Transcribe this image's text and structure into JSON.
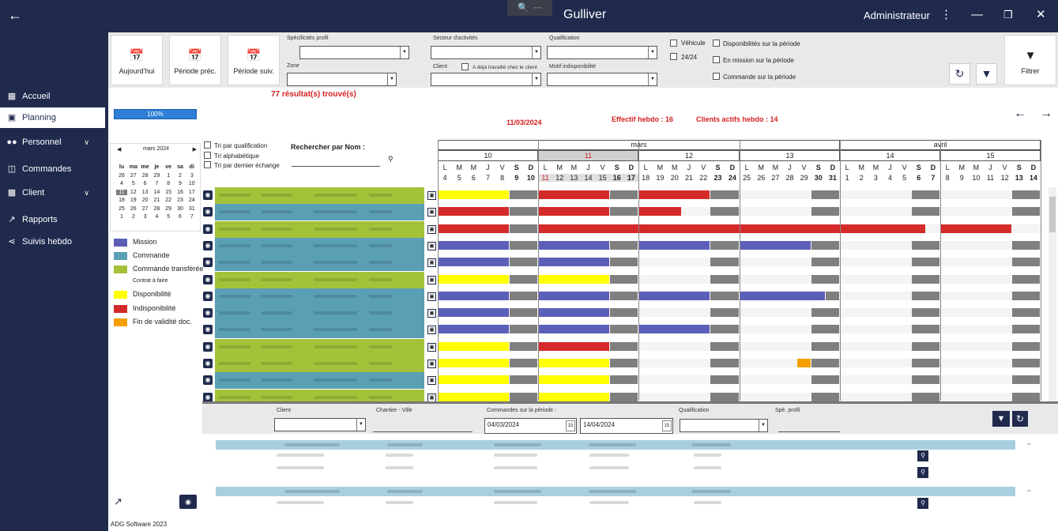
{
  "app": {
    "title": "Gulliver",
    "user": "Administrateur",
    "footer": "ADG Software 2023"
  },
  "sidebar": {
    "items": [
      {
        "label": "Accueil",
        "icon": "dashboard-icon"
      },
      {
        "label": "Planning",
        "icon": "calendar-icon",
        "active": true
      },
      {
        "label": "Personnel",
        "icon": "people-icon",
        "expandable": true
      },
      {
        "label": "Commandes",
        "icon": "orders-icon"
      },
      {
        "label": "Client",
        "icon": "building-icon",
        "expandable": true
      },
      {
        "label": "Rapports",
        "icon": "chart-icon"
      },
      {
        "label": "Suivis hebdo",
        "icon": "share-icon"
      }
    ]
  },
  "toolbar": {
    "today": "Aujourd'hui",
    "prev": "Période préc.",
    "next": "Période suiv.",
    "spec_profil": "Spécificités profil",
    "zone": "Zone",
    "secteur": "Secteur d'activités",
    "client": "Client",
    "deja_travaille": "A déjà travaillé chez le client",
    "qualification": "Qualification",
    "motif": "Motif indisponibilité",
    "vehicule": "Véhicule",
    "h24": "24/24",
    "dispo": "Disponibilités sur la période",
    "mission": "En mission sur la période",
    "commande": "Commande sur la période",
    "filtrer": "Filtrer"
  },
  "results": "77 résultat(s) trouvé(s)",
  "progress": {
    "label": "100%",
    "value": 100
  },
  "current_date": "11/03/2024",
  "effectif": "Effectif hebdo : 16",
  "clients_actifs": "Clients actifs hebdo : 14",
  "sort": {
    "by_qualification": "Tri par qualification",
    "alpha": "Tri alphabétique",
    "last_exchange": "Tri par dernier échange",
    "search_label": "Rechercher par Nom :"
  },
  "mini_calendar": {
    "month": "mars 2024",
    "days": [
      "lu",
      "ma",
      "me",
      "je",
      "ve",
      "sa",
      "di"
    ],
    "weeks": [
      [
        "26",
        "27",
        "28",
        "29",
        "1",
        "2",
        "3"
      ],
      [
        "4",
        "5",
        "6",
        "7",
        "8",
        "9",
        "10"
      ],
      [
        "11",
        "12",
        "13",
        "14",
        "15",
        "16",
        "17"
      ],
      [
        "18",
        "19",
        "20",
        "21",
        "22",
        "23",
        "24"
      ],
      [
        "25",
        "26",
        "27",
        "28",
        "29",
        "30",
        "31"
      ],
      [
        "1",
        "2",
        "3",
        "4",
        "5",
        "6",
        "7"
      ]
    ],
    "selected": "11"
  },
  "legend": [
    {
      "label": "Mission",
      "color": "#5b5fb8"
    },
    {
      "label": "Commande",
      "color": "#5b9fb4"
    },
    {
      "label": "Commande transférée",
      "color": "#a3c23a"
    },
    {
      "label": "Contrat à faire",
      "color": null
    },
    {
      "label": "Disponibilité",
      "color": "#ffff00"
    },
    {
      "label": "Indisponibilité",
      "color": "#d42a2a"
    },
    {
      "label": "Fin de validité doc.",
      "color": "#f5a000"
    }
  ],
  "planner": {
    "months": [
      {
        "name": "mars",
        "start": 0,
        "end": 28
      },
      {
        "name": "avril",
        "start": 28,
        "end": 42
      }
    ],
    "weeks": [
      "10",
      "11",
      "12",
      "13",
      "14",
      "15"
    ],
    "highlight_week": "11",
    "day_letters": [
      "L",
      "M",
      "M",
      "J",
      "V",
      "S",
      "D"
    ],
    "days": [
      "4",
      "5",
      "6",
      "7",
      "8",
      "9",
      "10",
      "11",
      "12",
      "13",
      "14",
      "15",
      "16",
      "17",
      "18",
      "19",
      "20",
      "21",
      "22",
      "23",
      "24",
      "25",
      "26",
      "27",
      "28",
      "29",
      "30",
      "31",
      "1",
      "2",
      "3",
      "4",
      "5",
      "6",
      "7",
      "8",
      "9",
      "10",
      "11",
      "12",
      "13",
      "14"
    ],
    "rows": [
      {
        "type": "Commande transférée",
        "segs": [
          [
            "yellow",
            0,
            5
          ],
          [
            "red",
            7,
            12
          ],
          [
            "red",
            14,
            19
          ],
          [
            "grey",
            5,
            7
          ],
          [
            "grey",
            12,
            14
          ],
          [
            "grey",
            19,
            21
          ],
          [
            "grey",
            26,
            28
          ],
          [
            "grey",
            33,
            35
          ],
          [
            "grey",
            40,
            42
          ]
        ]
      },
      {
        "type": "Commande",
        "segs": [
          [
            "red",
            0,
            5
          ],
          [
            "red",
            7,
            12
          ],
          [
            "red",
            14,
            17
          ],
          [
            "grey",
            5,
            7
          ],
          [
            "grey",
            12,
            14
          ],
          [
            "grey",
            19,
            21
          ],
          [
            "grey",
            26,
            28
          ],
          [
            "grey",
            33,
            35
          ],
          [
            "grey",
            40,
            42
          ]
        ]
      },
      {
        "type": "Commande transférée",
        "segs": [
          [
            "red",
            0,
            5
          ],
          [
            "red",
            7,
            34
          ],
          [
            "red",
            35,
            40
          ],
          [
            "grey",
            5,
            7
          ]
        ]
      },
      {
        "type": "Commande",
        "segs": [
          [
            "purple",
            0,
            5
          ],
          [
            "purple",
            7,
            12
          ],
          [
            "purple",
            14,
            19
          ],
          [
            "purple",
            21,
            26
          ],
          [
            "grey",
            5,
            7
          ],
          [
            "grey",
            12,
            14
          ],
          [
            "grey",
            19,
            21
          ],
          [
            "grey",
            26,
            28
          ],
          [
            "grey",
            33,
            35
          ],
          [
            "grey",
            40,
            42
          ]
        ]
      },
      {
        "type": "Commande",
        "segs": [
          [
            "purple",
            0,
            5
          ],
          [
            "purple",
            7,
            12
          ],
          [
            "grey",
            5,
            7
          ],
          [
            "grey",
            12,
            14
          ],
          [
            "grey",
            19,
            21
          ],
          [
            "grey",
            26,
            28
          ],
          [
            "grey",
            33,
            35
          ],
          [
            "grey",
            40,
            42
          ]
        ]
      },
      {
        "type": "Commande transférée",
        "segs": [
          [
            "yellow",
            0,
            5
          ],
          [
            "yellow",
            7,
            12
          ],
          [
            "grey",
            5,
            7
          ],
          [
            "grey",
            12,
            14
          ],
          [
            "grey",
            19,
            21
          ],
          [
            "grey",
            26,
            28
          ],
          [
            "grey",
            33,
            35
          ],
          [
            "grey",
            40,
            42
          ]
        ]
      },
      {
        "type": "Commande",
        "segs": [
          [
            "purple",
            0,
            5
          ],
          [
            "purple",
            7,
            12
          ],
          [
            "purple",
            14,
            19
          ],
          [
            "purple",
            21,
            27
          ],
          [
            "grey",
            5,
            7
          ],
          [
            "grey",
            12,
            14
          ],
          [
            "grey",
            19,
            21
          ],
          [
            "grey",
            27,
            28
          ],
          [
            "grey",
            33,
            35
          ],
          [
            "grey",
            40,
            42
          ]
        ]
      },
      {
        "type": "Commande",
        "segs": [
          [
            "purple",
            0,
            5
          ],
          [
            "purple",
            7,
            12
          ],
          [
            "grey",
            5,
            7
          ],
          [
            "grey",
            12,
            14
          ],
          [
            "grey",
            19,
            21
          ],
          [
            "grey",
            26,
            28
          ],
          [
            "grey",
            33,
            35
          ],
          [
            "grey",
            40,
            42
          ]
        ]
      },
      {
        "type": "Commande",
        "segs": [
          [
            "purple",
            0,
            5
          ],
          [
            "purple",
            7,
            12
          ],
          [
            "purple",
            14,
            19
          ],
          [
            "grey",
            5,
            7
          ],
          [
            "grey",
            12,
            14
          ],
          [
            "grey",
            19,
            21
          ],
          [
            "grey",
            26,
            28
          ],
          [
            "grey",
            33,
            35
          ],
          [
            "grey",
            40,
            42
          ]
        ]
      },
      {
        "type": "Commande transférée",
        "segs": [
          [
            "yellow",
            0,
            5
          ],
          [
            "red",
            7,
            12
          ],
          [
            "grey",
            5,
            7
          ],
          [
            "grey",
            12,
            14
          ],
          [
            "grey",
            19,
            21
          ],
          [
            "grey",
            26,
            28
          ],
          [
            "grey",
            33,
            35
          ],
          [
            "grey",
            40,
            42
          ]
        ]
      },
      {
        "type": "Commande transférée",
        "segs": [
          [
            "yellow",
            0,
            5
          ],
          [
            "yellow",
            7,
            12
          ],
          [
            "orange",
            25,
            26
          ],
          [
            "grey",
            5,
            7
          ],
          [
            "grey",
            12,
            14
          ],
          [
            "grey",
            19,
            21
          ],
          [
            "grey",
            26,
            28
          ],
          [
            "grey",
            33,
            35
          ],
          [
            "grey",
            40,
            42
          ]
        ]
      },
      {
        "type": "Commande",
        "segs": [
          [
            "yellow",
            0,
            5
          ],
          [
            "yellow",
            7,
            12
          ],
          [
            "grey",
            5,
            7
          ],
          [
            "grey",
            12,
            14
          ],
          [
            "grey",
            19,
            21
          ],
          [
            "grey",
            26,
            28
          ],
          [
            "grey",
            33,
            35
          ],
          [
            "grey",
            40,
            42
          ]
        ]
      },
      {
        "type": "Commande transférée",
        "segs": [
          [
            "yellow",
            0,
            5
          ],
          [
            "yellow",
            7,
            12
          ],
          [
            "grey",
            5,
            7
          ],
          [
            "grey",
            12,
            14
          ],
          [
            "grey",
            19,
            21
          ],
          [
            "grey",
            26,
            28
          ],
          [
            "grey",
            33,
            35
          ],
          [
            "grey",
            40,
            42
          ]
        ]
      }
    ]
  },
  "bottom": {
    "client": "Client",
    "chantier": "Chantier - Ville",
    "commandes": "Commandes sur la période :",
    "date_from": "04/03/2024",
    "date_to": "14/04/2024",
    "qualification": "Qualification",
    "spe_profil": "Spé. profil",
    "cal_num": "15"
  },
  "colors": {
    "nav_bg": "#1f2a4d",
    "red_text": "#d32020",
    "grey_block": "#7f7f7f",
    "row_commande": "#5b9fb4",
    "row_transferee": "#a3c23a"
  }
}
